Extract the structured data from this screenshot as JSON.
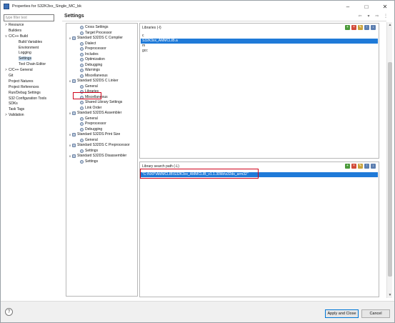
{
  "window": {
    "title": "Properties for S32K3xx_Single_MC_bk",
    "controls": {
      "minimize": "–",
      "maximize": "□",
      "close": "✕"
    }
  },
  "filter": {
    "placeholder": "type filter text"
  },
  "nav": {
    "items": [
      {
        "label": "Resource",
        "level": 1,
        "twisty": ">"
      },
      {
        "label": "Builders",
        "level": 1,
        "twisty": ""
      },
      {
        "label": "C/C++ Build",
        "level": 1,
        "twisty": "v"
      },
      {
        "label": "Build Variables",
        "level": 2,
        "twisty": ""
      },
      {
        "label": "Environment",
        "level": 2,
        "twisty": ""
      },
      {
        "label": "Logging",
        "level": 2,
        "twisty": ""
      },
      {
        "label": "Settings",
        "level": 2,
        "twisty": ""
      },
      {
        "label": "Tool Chain Editor",
        "level": 2,
        "twisty": ""
      },
      {
        "label": "C/C++ General",
        "level": 1,
        "twisty": ">"
      },
      {
        "label": "Git",
        "level": 1,
        "twisty": ""
      },
      {
        "label": "Project Natures",
        "level": 1,
        "twisty": ""
      },
      {
        "label": "Project References",
        "level": 1,
        "twisty": ""
      },
      {
        "label": "Run/Debug Settings",
        "level": 1,
        "twisty": ""
      },
      {
        "label": "S32 Configuration Tools",
        "level": 1,
        "twisty": ""
      },
      {
        "label": "SDKs",
        "level": 1,
        "twisty": ""
      },
      {
        "label": "Task Tags",
        "level": 1,
        "twisty": ""
      },
      {
        "label": "Validation",
        "level": 1,
        "twisty": ">"
      }
    ]
  },
  "page": {
    "title": "Settings"
  },
  "header_tools": {
    "back": "⇦",
    "back_menu": "▾",
    "forward": "⇨",
    "more": "⋮"
  },
  "tool_tree": {
    "items": [
      {
        "label": "Cross Settings",
        "level": 1,
        "twisty": "",
        "icon": "gear"
      },
      {
        "label": "Target Processor",
        "level": 1,
        "twisty": "",
        "icon": "gear"
      },
      {
        "label": "Standard S32DS C Compiler",
        "level": 0,
        "twisty": "v",
        "icon": "tool"
      },
      {
        "label": "Dialect",
        "level": 1,
        "twisty": "",
        "icon": "gear"
      },
      {
        "label": "Preprocessor",
        "level": 1,
        "twisty": "",
        "icon": "gear"
      },
      {
        "label": "Includes",
        "level": 1,
        "twisty": "",
        "icon": "gear"
      },
      {
        "label": "Optimization",
        "level": 1,
        "twisty": "",
        "icon": "gear"
      },
      {
        "label": "Debugging",
        "level": 1,
        "twisty": "",
        "icon": "gear"
      },
      {
        "label": "Warnings",
        "level": 1,
        "twisty": "",
        "icon": "gear"
      },
      {
        "label": "Miscellaneous",
        "level": 1,
        "twisty": "",
        "icon": "gear"
      },
      {
        "label": "Standard S32DS C Linker",
        "level": 0,
        "twisty": "v",
        "icon": "tool"
      },
      {
        "label": "General",
        "level": 1,
        "twisty": "",
        "icon": "gear"
      },
      {
        "label": "Libraries",
        "level": 1,
        "twisty": "",
        "icon": "gear"
      },
      {
        "label": "Miscellaneous",
        "level": 1,
        "twisty": "",
        "icon": "gear"
      },
      {
        "label": "Shared Library Settings",
        "level": 1,
        "twisty": "",
        "icon": "gear"
      },
      {
        "label": "Link Order",
        "level": 1,
        "twisty": "",
        "icon": "gear"
      },
      {
        "label": "Standard S32DS Assembler",
        "level": 0,
        "twisty": "v",
        "icon": "tool"
      },
      {
        "label": "General",
        "level": 1,
        "twisty": "",
        "icon": "gear"
      },
      {
        "label": "Preprocessor",
        "level": 1,
        "twisty": "",
        "icon": "gear"
      },
      {
        "label": "Debugging",
        "level": 1,
        "twisty": "",
        "icon": "gear"
      },
      {
        "label": "Standard S32DS Print Size",
        "level": 0,
        "twisty": "v",
        "icon": "tool"
      },
      {
        "label": "General",
        "level": 1,
        "twisty": "",
        "icon": "gear"
      },
      {
        "label": "Standard S32DS C Preprocessor",
        "level": 0,
        "twisty": "v",
        "icon": "tool"
      },
      {
        "label": "Settings",
        "level": 1,
        "twisty": "",
        "icon": "gear"
      },
      {
        "label": "Standard S32DS Disassembler",
        "level": 0,
        "twisty": "v",
        "icon": "tool"
      },
      {
        "label": "Settings",
        "level": 1,
        "twisty": "",
        "icon": "gear"
      }
    ]
  },
  "libraries": {
    "header": "Libraries (-l)",
    "items": [
      {
        "value": "c",
        "selected": false
      },
      {
        "value": "S32K3xx_AMMCLIB.a",
        "selected": true
      },
      {
        "value": "m",
        "selected": false
      },
      {
        "value": "gcc",
        "selected": false
      }
    ]
  },
  "library_paths": {
    "header": "Library search path (-L)",
    "items": [
      {
        "value": "\"C:\\NXP\\AMMCLIB\\S32K3xx_AMMCLIB_v1.1.30\\lib\\s32ds_arm32\"",
        "selected": true
      }
    ]
  },
  "panel_tool_icons": {
    "add": "+",
    "delete": "×",
    "edit": "✎",
    "up": "↑",
    "down": "↓"
  },
  "footer": {
    "help": "?",
    "apply_close": "Apply and Close",
    "cancel": "Cancel"
  },
  "colors": {
    "selection": "#1f7ad8",
    "highlight_box": "#d0021b",
    "default_button_border": "#0078d7"
  }
}
